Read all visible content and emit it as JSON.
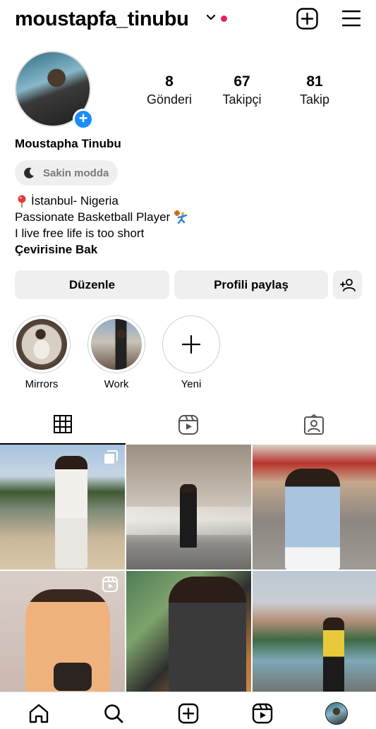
{
  "header": {
    "username": "moustapfa_tinubu"
  },
  "profile": {
    "full_name": "Moustapha Tinubu",
    "stats": [
      {
        "value": "8",
        "label": "Gönderi"
      },
      {
        "value": "67",
        "label": "Takipçi"
      },
      {
        "value": "81",
        "label": "Takip"
      }
    ],
    "quiet_mode": "Sakin modda",
    "bio": {
      "location": "İstanbul- Nigeria",
      "line2": "Passionate Basketball Player",
      "line3": "I live free life is too short",
      "translate": "Çevirisine Bak"
    }
  },
  "actions": {
    "edit": "Düzenle",
    "share": "Profili paylaş"
  },
  "highlights": [
    {
      "label": "Mirrors"
    },
    {
      "label": "Work"
    },
    {
      "label": "Yeni"
    }
  ],
  "colors": {
    "accent_blue": "#1a8cff",
    "notification": "#e0245e",
    "button_bg": "#efefef"
  },
  "icons": {
    "location": "round-pushpin",
    "bio_emoji": "person-playing-basketball",
    "grid_tab": "grid-icon",
    "reels_tab": "reels-icon",
    "tagged_tab": "tagged-icon"
  }
}
